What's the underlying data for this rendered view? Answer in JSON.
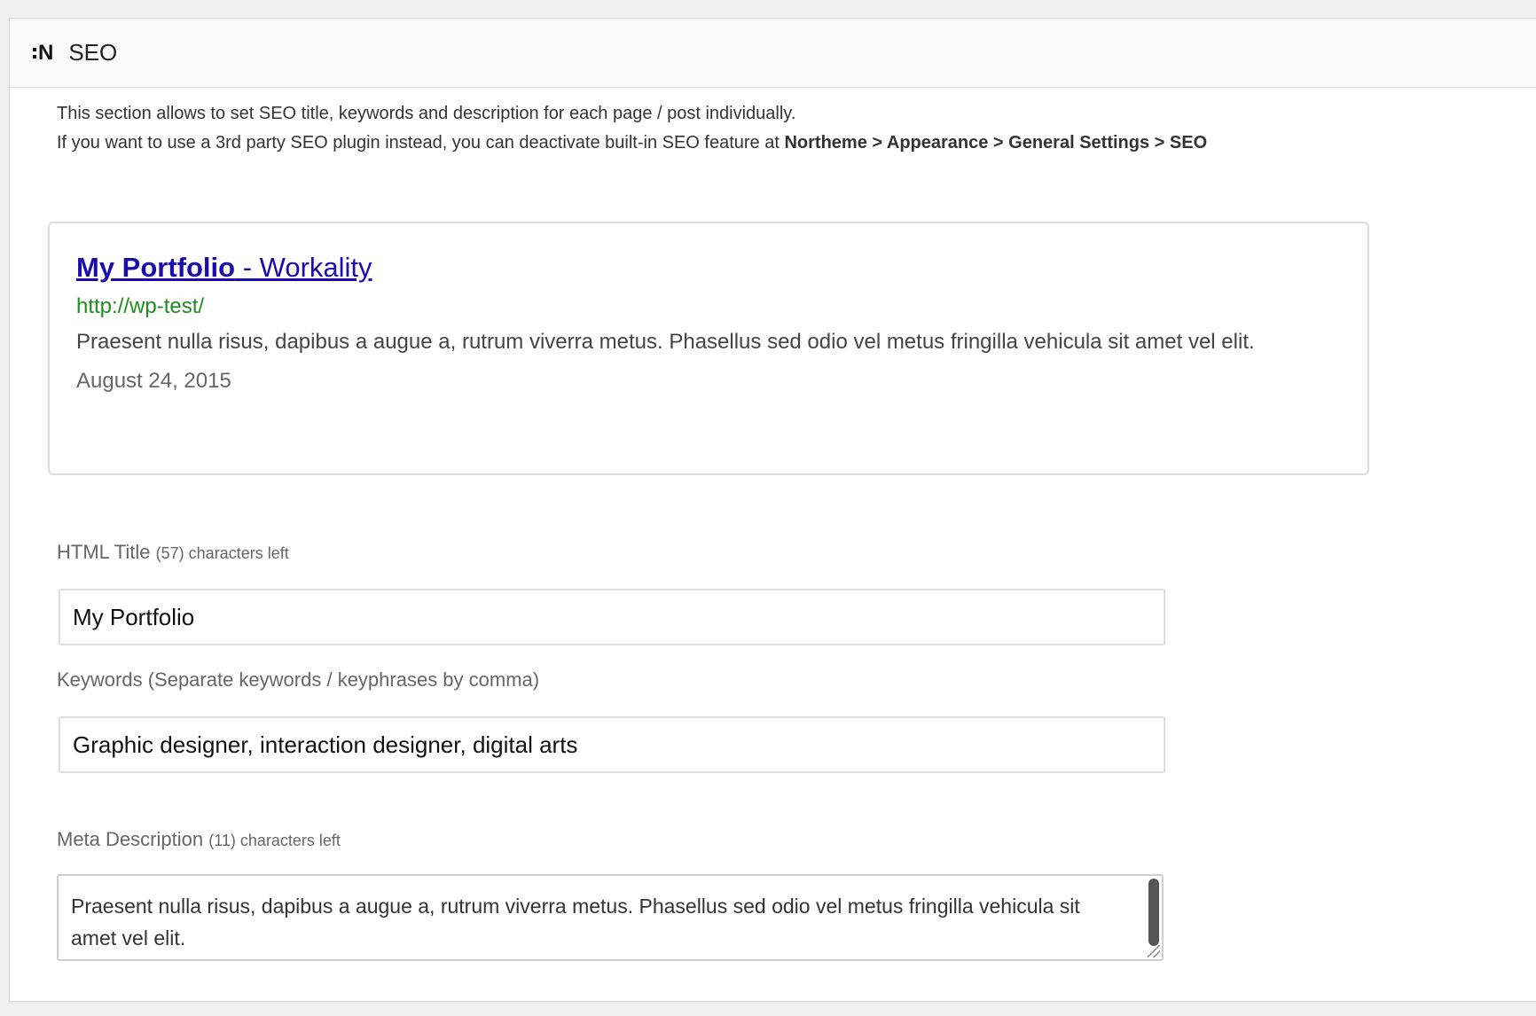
{
  "panel": {
    "title": "SEO",
    "icon": "northeme-logo-icon",
    "logo_text": "N"
  },
  "intro": {
    "line1": "This section allows to set SEO title, keywords and description for each page / post individually.",
    "line2_prefix": "If you want to use a 3rd party SEO plugin instead, you can deactivate built-in SEO feature at ",
    "line2_path": "Northeme > Appearance > General Settings > SEO"
  },
  "preview": {
    "page_title": "My Portfolio",
    "site_suffix": " - Workality",
    "url": "http://wp-test/",
    "description": "Praesent nulla risus, dapibus a augue a, rutrum viverra metus. Phasellus sed odio vel metus fringilla vehicula sit amet vel elit.",
    "date": "August 24, 2015",
    "colors": {
      "title": "#1a0dab",
      "url": "#1e8e1e"
    }
  },
  "fields": {
    "html_title": {
      "label": "HTML Title",
      "counter": "(57) characters left",
      "value": "My Portfolio"
    },
    "keywords": {
      "label": "Keywords (Separate keywords / keyphrases by comma)",
      "value": "Graphic designer, interaction designer, digital arts"
    },
    "meta_description": {
      "label": "Meta Description",
      "counter": "(11) characters left",
      "value": "Praesent nulla risus, dapibus a augue a, rutrum viverra metus. Phasellus sed odio vel metus fringilla vehicula sit amet vel elit."
    }
  }
}
